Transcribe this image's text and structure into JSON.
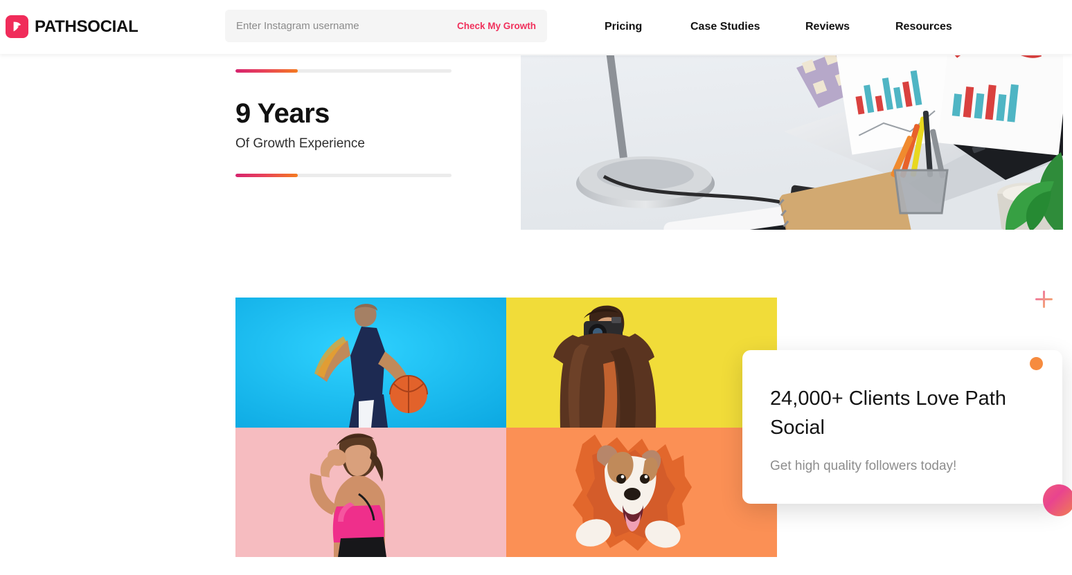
{
  "brand": {
    "name": "PATHSOCIAL",
    "mark_icon": "path-arrow-logo-icon",
    "accent_pink": "#f02c5a",
    "accent_orange": "#f47b20"
  },
  "search": {
    "placeholder": "Enter Instagram username",
    "value": "",
    "cta_label": "Check My Growth"
  },
  "nav": {
    "items": [
      {
        "label": "Pricing"
      },
      {
        "label": "Case Studies"
      },
      {
        "label": "Reviews"
      },
      {
        "label": "Resources"
      }
    ]
  },
  "stat": {
    "number": "9 Years",
    "label": "Of Growth Experience",
    "bar_top_percent": 29,
    "bar_bottom_percent": 29,
    "bar_gradient_from": "#d6246e",
    "bar_gradient_to": "#f47b20"
  },
  "hero_photo": {
    "alt": "Overhead desk with laptop, tablet, desk lamp, notebooks, charts and plant",
    "icon": "desk-workspace-photo"
  },
  "photo_grid": {
    "tiles": [
      {
        "alt": "Basketball player dribbling",
        "background": "#17bcf0",
        "icon": "basketball-player-photo"
      },
      {
        "alt": "Woman photographer with camera",
        "background": "#efd52b",
        "icon": "photographer-photo"
      },
      {
        "alt": "Fitness woman flexing arm",
        "background": "#f6bcc0",
        "icon": "fitness-woman-photo"
      },
      {
        "alt": "Puppy bursting through paper",
        "background": "#fb9055",
        "icon": "puppy-photo"
      }
    ]
  },
  "card": {
    "title": "24,000+ Clients Love Path Social",
    "subtitle": "Get high quality followers today!",
    "dot_orange_color": "#f68b3f",
    "dot_gradient_from": "#e9448e",
    "dot_gradient_to": "#f08050"
  },
  "decor": {
    "plus_icon": "plus-decoration-icon"
  }
}
